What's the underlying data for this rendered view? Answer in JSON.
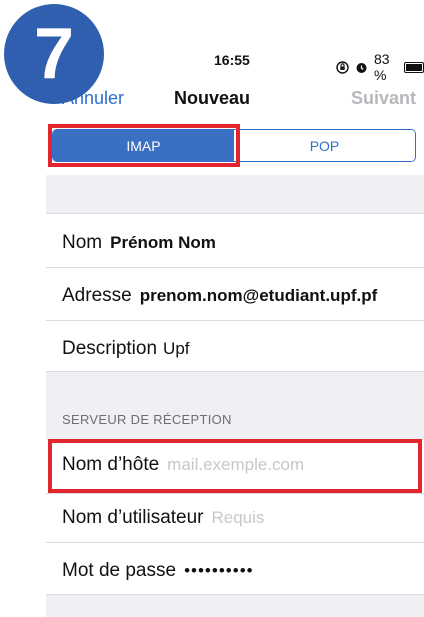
{
  "step_badge": "7",
  "status_bar": {
    "time": "16:55",
    "battery_percent": "83 %",
    "battery_level": 0.83,
    "icons": [
      "orientation-lock-icon",
      "alarm-icon",
      "battery-icon"
    ]
  },
  "nav": {
    "cancel": "Annuler",
    "title": "Nouveau",
    "next": "Suivant"
  },
  "segmented": {
    "options": [
      "IMAP",
      "POP"
    ],
    "selected": "IMAP"
  },
  "account": {
    "name_label": "Nom",
    "name_value": "Prénom Nom",
    "address_label": "Adresse",
    "address_value": "prenom.nom@etudiant.upf.pf",
    "description_label": "Description",
    "description_value": "Upf"
  },
  "incoming_server": {
    "header": "SERVEUR DE RÉCEPTION",
    "hostname_label": "Nom d’hôte",
    "hostname_placeholder": "mail.exemple.com",
    "username_label": "Nom d’utilisateur",
    "username_placeholder": "Requis",
    "password_label": "Mot de passe",
    "password_value": "••••••••••"
  },
  "colors": {
    "accent": "#2d6fce",
    "badge": "#2f5fae",
    "highlight": "#e1262d",
    "group_bg": "#efeff4"
  }
}
